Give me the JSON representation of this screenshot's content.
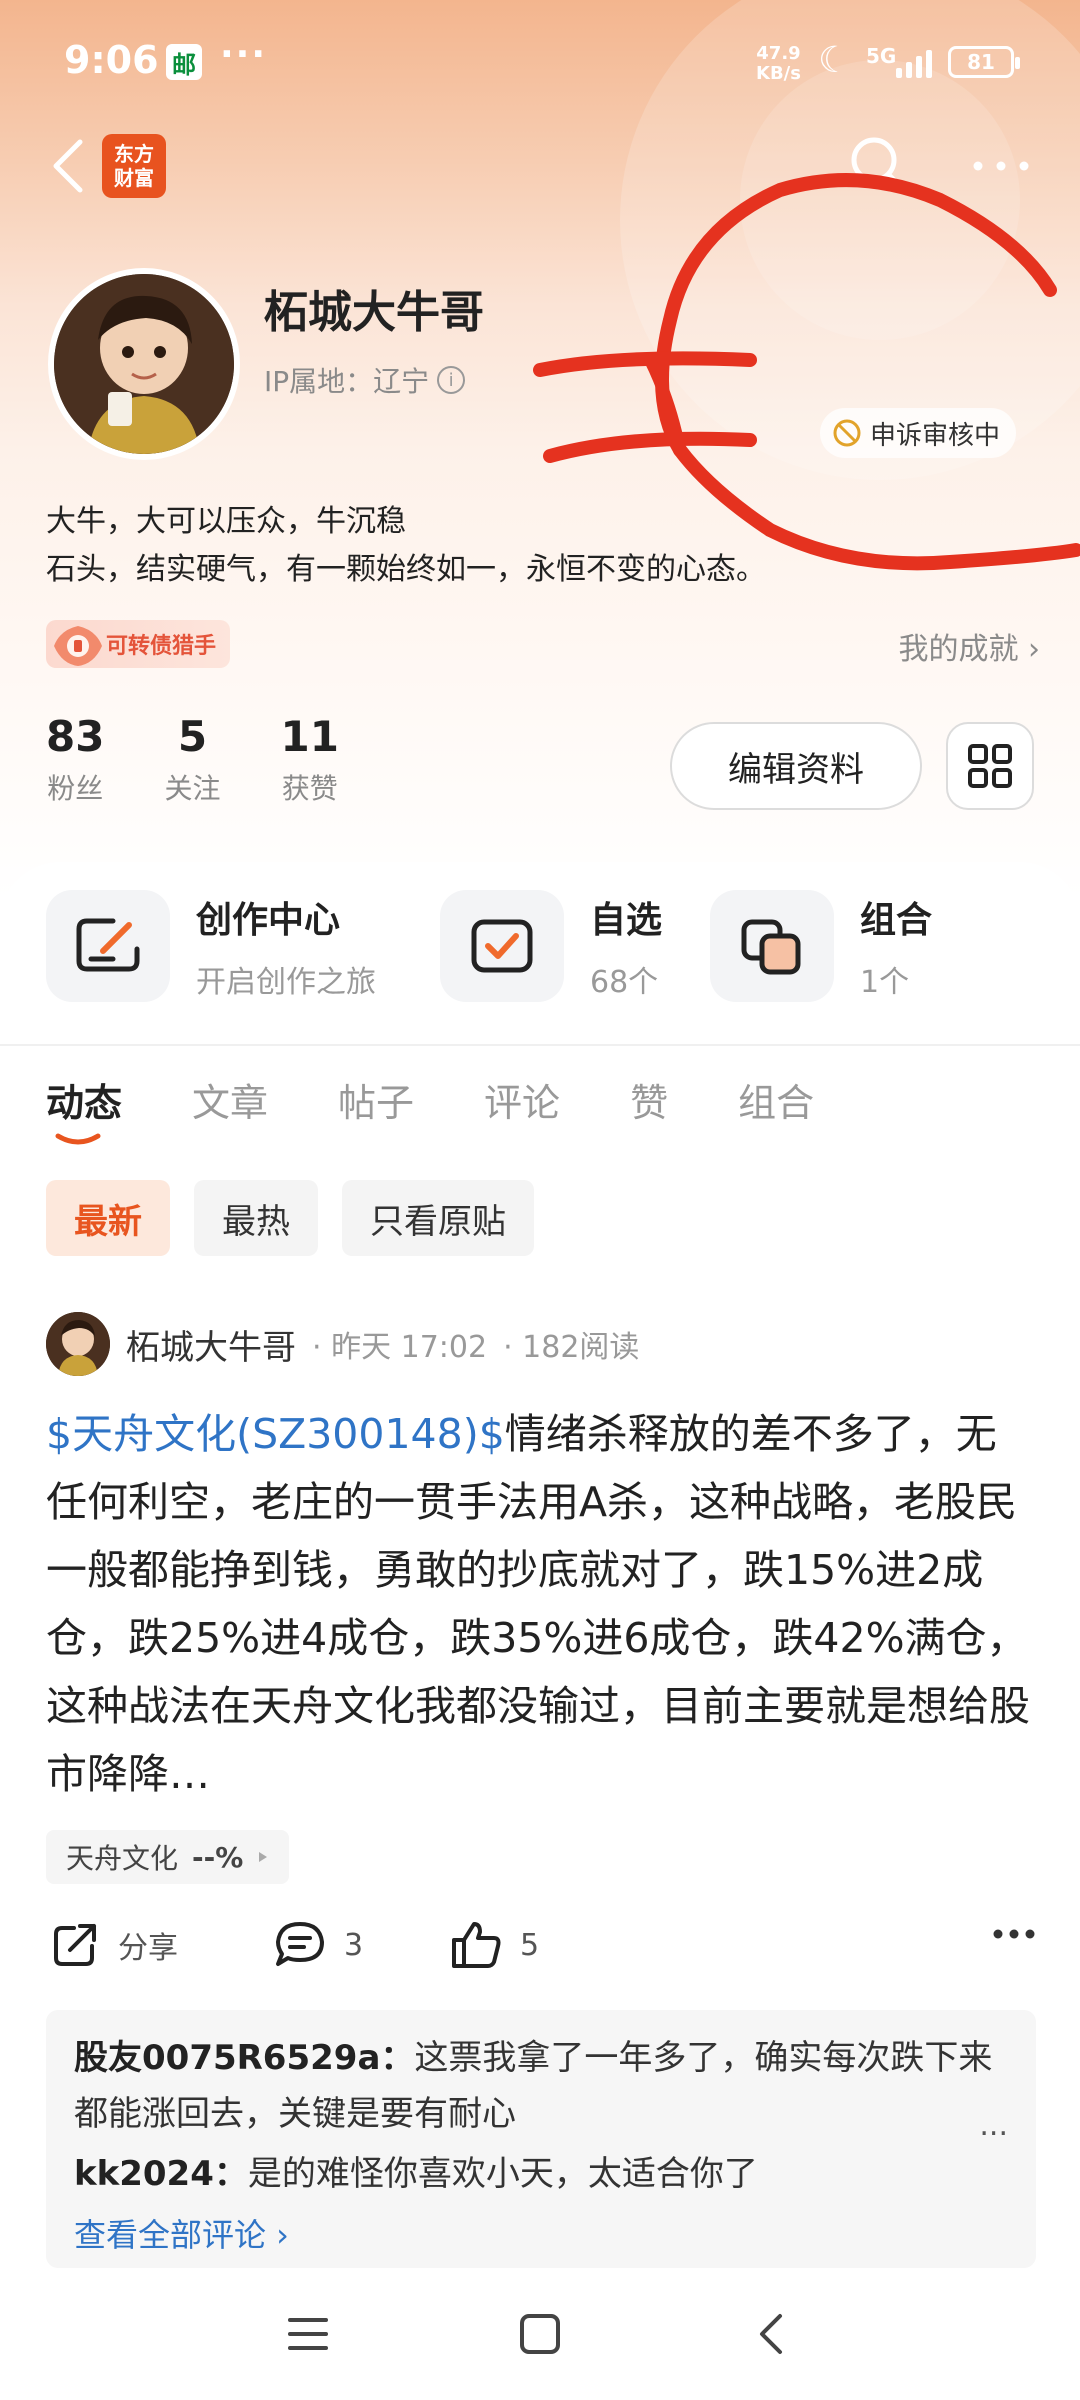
{
  "status_bar": {
    "time": "9:06",
    "app_icon": "邮",
    "overflow": "···",
    "net_speed_value": "47.9",
    "net_speed_unit": "KB/s",
    "network": "5G",
    "battery": "81"
  },
  "brand": {
    "line1": "东方",
    "line2": "财富"
  },
  "profile": {
    "username": "柘城大牛哥",
    "ip_location": "IP属地：辽宁",
    "appeal_status": "申诉审核中",
    "bio_line1": "大牛，大可以压众，牛沉稳",
    "bio_line2": "石头，结实硬气，有一颗始终如一，永恒不变的心态。",
    "honor_badge": "可转债猎手",
    "achievements": "我的成就 ›",
    "stats": [
      {
        "value": "83",
        "label": "粉丝"
      },
      {
        "value": "5",
        "label": "关注"
      },
      {
        "value": "11",
        "label": "获赞"
      }
    ],
    "edit_button": "编辑资料"
  },
  "shortcuts": [
    {
      "title": "创作中心",
      "subtitle": "开启创作之旅",
      "icon": "pen-icon"
    },
    {
      "title": "自选",
      "subtitle": "68个",
      "icon": "checkbox-icon"
    },
    {
      "title": "组合",
      "subtitle": "1个",
      "icon": "portfolio-icon"
    }
  ],
  "tabs": [
    "动态",
    "文章",
    "帖子",
    "评论",
    "赞",
    "组合"
  ],
  "filters": [
    "最新",
    "最热",
    "只看原贴"
  ],
  "post": {
    "author": "柘城大牛哥",
    "time": "· 昨天 17:02",
    "reads": "· 182阅读",
    "stock_link": "$天舟文化(SZ300148)$",
    "body": "情绪杀释放的差不多了，无任何利空，老庄的一贯手法用A杀，这种战略，老股民一般都能挣到钱，勇敢的抄底就对了，跌15%进2成仓，跌25%进4成仓，跌35%进6成仓，跌42%满仓，这种战法在天舟文化我都没输过，目前主要就是想给股市降降…",
    "stock_tag_name": "天舟文化",
    "stock_tag_change": "--%",
    "share_label": "分享",
    "comment_count": "3",
    "like_count": "5"
  },
  "comments": [
    {
      "user": "股友0075R6529a：",
      "text": "这票我拿了一年多了，确实每次跌下来都能涨回去，关键是要有耐心"
    },
    {
      "user": "kk2024：",
      "text": "是的难怪你喜欢小天，太适合你了"
    }
  ],
  "comments_more": "...",
  "view_all_comments": "查看全部评论 ›",
  "colors": {
    "accent": "#e8551f",
    "link": "#2f74c6",
    "brand": "#e8531f",
    "scribble": "#e5321f"
  }
}
